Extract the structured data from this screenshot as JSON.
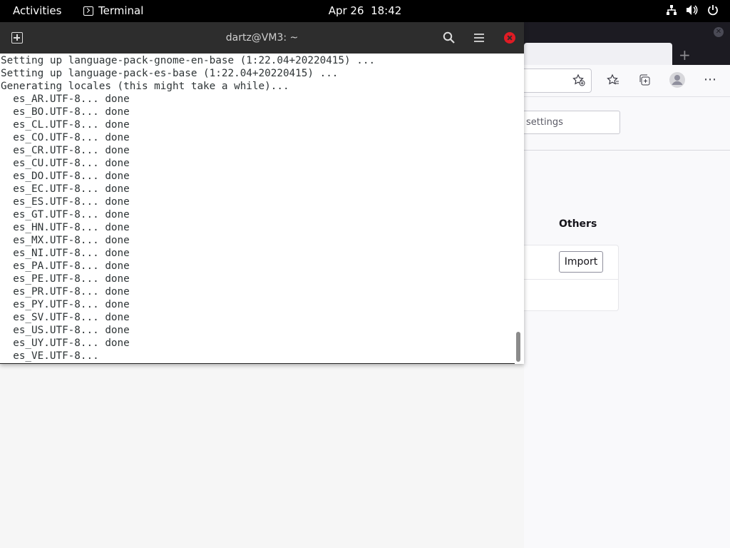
{
  "topbar": {
    "activities": "Activities",
    "app_name": "Terminal",
    "date": "Apr 26",
    "time": "18:42",
    "icons": [
      "network-icon",
      "volume-icon",
      "power-icon"
    ]
  },
  "terminal": {
    "title": "dartz@VM3: ~",
    "icons": [
      "new-tab-icon",
      "search-icon",
      "hamburger-menu-icon",
      "close-icon"
    ],
    "lines": [
      "Setting up language-pack-gnome-en-base (1:22.04+20220415) ...",
      "Setting up language-pack-es-base (1:22.04+20220415) ...",
      "Generating locales (this might take a while)...",
      "  es_AR.UTF-8... done",
      "  es_BO.UTF-8... done",
      "  es_CL.UTF-8... done",
      "  es_CO.UTF-8... done",
      "  es_CR.UTF-8... done",
      "  es_CU.UTF-8... done",
      "  es_DO.UTF-8... done",
      "  es_EC.UTF-8... done",
      "  es_ES.UTF-8... done",
      "  es_GT.UTF-8... done",
      "  es_HN.UTF-8... done",
      "  es_MX.UTF-8... done",
      "  es_NI.UTF-8... done",
      "  es_PA.UTF-8... done",
      "  es_PE.UTF-8... done",
      "  es_PR.UTF-8... done",
      "  es_PY.UTF-8... done",
      "  es_SV.UTF-8... done",
      "  es_US.UTF-8... done",
      "  es_UY.UTF-8... done",
      "  es_VE.UTF-8..."
    ]
  },
  "browser": {
    "settings_search_text": "settings",
    "others_heading": "Others",
    "import_button": "Import",
    "icons": [
      "bookmark-star-add-icon",
      "bookmarks-icon",
      "collections-icon",
      "account-avatar-icon",
      "more-options-icon",
      "new-tab-plus-icon",
      "window-close-icon"
    ]
  },
  "colors": {
    "topbar_bg": "#000000",
    "terminal_header_bg": "#2d2d2d",
    "terminal_text": "#2e3436",
    "close_button": "#e01b24",
    "browser_tabstrip": "#1c1b22"
  }
}
